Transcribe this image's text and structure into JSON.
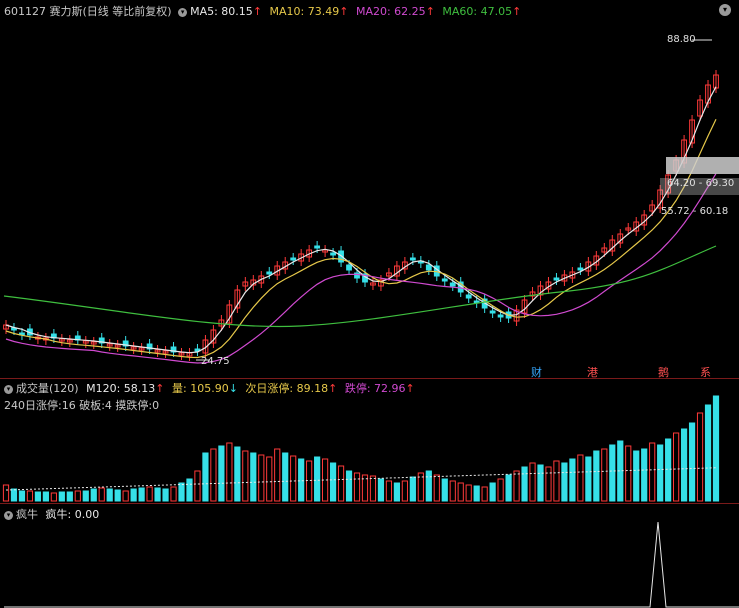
{
  "header": {
    "code": "601127",
    "name": "赛力斯",
    "period": "(日线 等比前复权)",
    "ma": [
      {
        "label": "MA5: 80.15",
        "arrow": "↑",
        "color": "#e8e8e8"
      },
      {
        "label": "MA10: 73.49",
        "arrow": "↑",
        "color": "#e6c84a"
      },
      {
        "label": "MA20: 62.25",
        "arrow": "↑",
        "color": "#d04ad0"
      },
      {
        "label": "MA60: 47.05",
        "arrow": "↑",
        "color": "#3fbf3f"
      }
    ],
    "corner_icon": "chevron-down-icon"
  },
  "price_chart": {
    "high_label": "88.80",
    "low_label": "24.75",
    "range1": "64.20 - 69.30",
    "range2": "55.72 - 60.18",
    "markers": [
      "财",
      "港",
      "鹅",
      "系"
    ],
    "colors": {
      "up": "#ff3a3a",
      "down": "#36e0e8",
      "ma5": "#e8e8e8",
      "ma10": "#e6c84a",
      "ma20": "#d04ad0",
      "ma60": "#3fbf3f"
    }
  },
  "volume_panel": {
    "title": "成交量(120)",
    "m120": "M120: 58.13",
    "m120_arrow": "↑",
    "vol": "量: 105.90",
    "vol_arrow": "↓",
    "next_limit": "次日涨停: 89.18",
    "next_limit_arrow": "↑",
    "limit_down": "跌停: 72.96",
    "limit_down_arrow": "↑",
    "stats": "240日涨停:16 破板:4 摸跌停:0"
  },
  "indicator_panel": {
    "title": "疯牛",
    "line": "疯牛: 0.00"
  },
  "chart_data": {
    "type": "candlestick",
    "ma_values": {
      "MA5": 80.15,
      "MA10": 73.49,
      "MA20": 62.25,
      "MA60": 47.05
    },
    "high": 88.8,
    "low": 24.75,
    "volume_m120": 58.13,
    "volume_last": 105.9
  }
}
